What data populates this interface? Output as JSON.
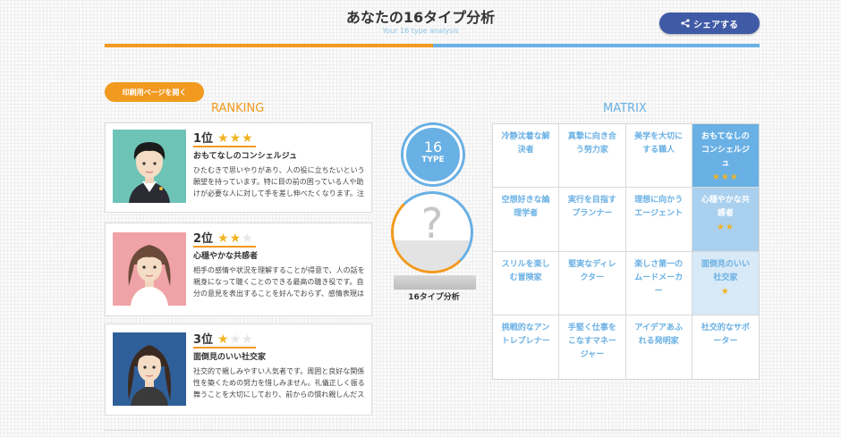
{
  "header": {
    "title": "あなたの16タイプ分析",
    "subtitle": "Your 16 type analysis",
    "share_label": "シェアする"
  },
  "print_button": "印刷用ページを開く",
  "ranking": {
    "heading": "RANKING",
    "cards": [
      {
        "rank": "1位",
        "stars": 3,
        "title": "おもてなしのコンシェルジュ",
        "desc": "ひたむきで思いやりがあり、人の役に立ちたいという願望を持っています。特に目の前の困っている人や助けが必要な人に対して手を差し伸べたくなります。注意深さや丁寧さが要..."
      },
      {
        "rank": "2位",
        "stars": 2,
        "title": "心穏やかな共感者",
        "desc": "相手の感情や状況を理解することが得意で、人の話を親身になって聴くことのできる最高の聴き役です。自分の意見を表出することを好んでおらず、感情表現は穏やかです。周囲に..."
      },
      {
        "rank": "3位",
        "stars": 1,
        "title": "面倒見のいい社交家",
        "desc": "社交的で親しみやすい人気者です。周囲と良好な関係性を築くための努力を惜しみません。礼儀正しく振る舞うことを大切にしており、前からの慣れ親しんだスタイルにひかれやす..."
      }
    ]
  },
  "center": {
    "type_number": "16",
    "type_label": "TYPE",
    "question_mark": "?",
    "pedestal_label": "16タイプ分析"
  },
  "matrix": {
    "heading": "MATRIX",
    "cells": [
      {
        "label": "冷静沈着な解決者",
        "stars": ""
      },
      {
        "label": "真摯に向き合う努力家",
        "stars": ""
      },
      {
        "label": "美学を大切にする職人",
        "stars": ""
      },
      {
        "label": "おもてなしのコンシェルジュ",
        "stars": "★★★"
      },
      {
        "label": "空想好きな論理学者",
        "stars": ""
      },
      {
        "label": "実行を目指すプランナー",
        "stars": ""
      },
      {
        "label": "理想に向かうエージェント",
        "stars": ""
      },
      {
        "label": "心穏やかな共感者",
        "stars": "★★"
      },
      {
        "label": "スリルを楽しむ冒険家",
        "stars": ""
      },
      {
        "label": "堅実なディレクター",
        "stars": ""
      },
      {
        "label": "楽しさ第一のムードメーカー",
        "stars": ""
      },
      {
        "label": "面倒見のいい社交家",
        "stars": "★"
      },
      {
        "label": "挑戦的なアントレプレナー",
        "stars": ""
      },
      {
        "label": "手堅く仕事をこなすマネージャー",
        "stars": ""
      },
      {
        "label": "アイデアあふれる発明家",
        "stars": ""
      },
      {
        "label": "社交的なサポーター",
        "stars": ""
      }
    ]
  },
  "colors": {
    "orange": "#f19a1f",
    "blue": "#69b0e4",
    "navy": "#3f5aa6",
    "star": "#f2b420"
  }
}
